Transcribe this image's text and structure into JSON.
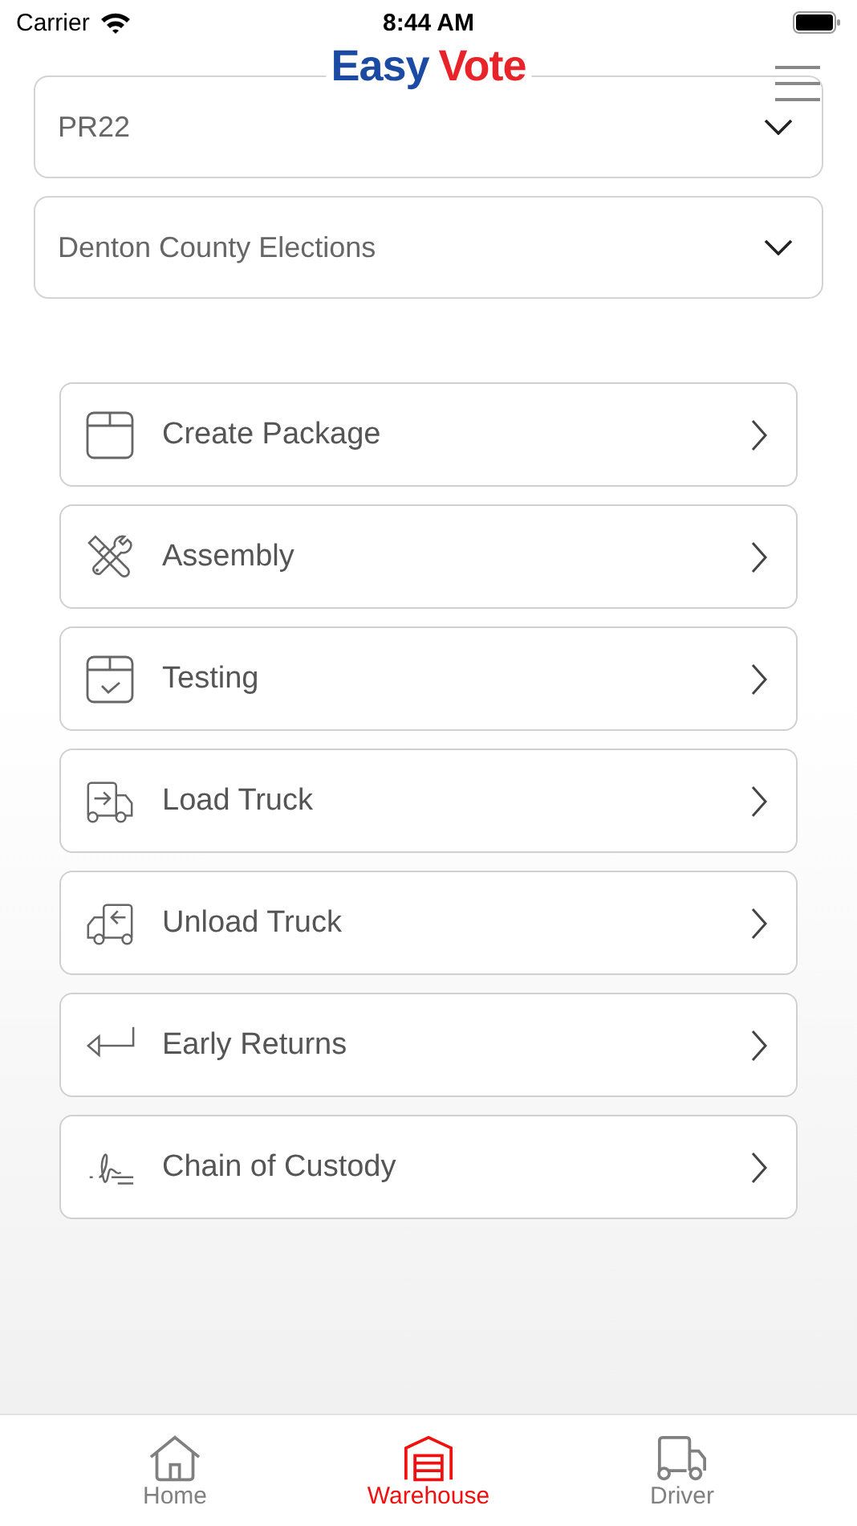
{
  "status_bar": {
    "carrier": "Carrier",
    "time": "8:44 AM"
  },
  "header": {
    "logo": [
      "Easy",
      "Vote"
    ]
  },
  "selects": [
    {
      "value": "PR22"
    },
    {
      "value": "Denton County Elections"
    }
  ],
  "menu": [
    {
      "kind": "package",
      "label": "Create Package"
    },
    {
      "kind": "tools",
      "label": "Assembly"
    },
    {
      "kind": "testing",
      "label": "Testing"
    },
    {
      "kind": "load",
      "label": "Load Truck"
    },
    {
      "kind": "unload",
      "label": "Unload Truck"
    },
    {
      "kind": "return",
      "label": "Early Returns"
    },
    {
      "kind": "signature",
      "label": "Chain of Custody"
    }
  ],
  "tabs": [
    {
      "kind": "home",
      "label": "Home",
      "selected": false
    },
    {
      "kind": "warehouse",
      "label": "Warehouse",
      "selected": true
    },
    {
      "kind": "truck",
      "label": "Driver",
      "selected": false
    }
  ]
}
